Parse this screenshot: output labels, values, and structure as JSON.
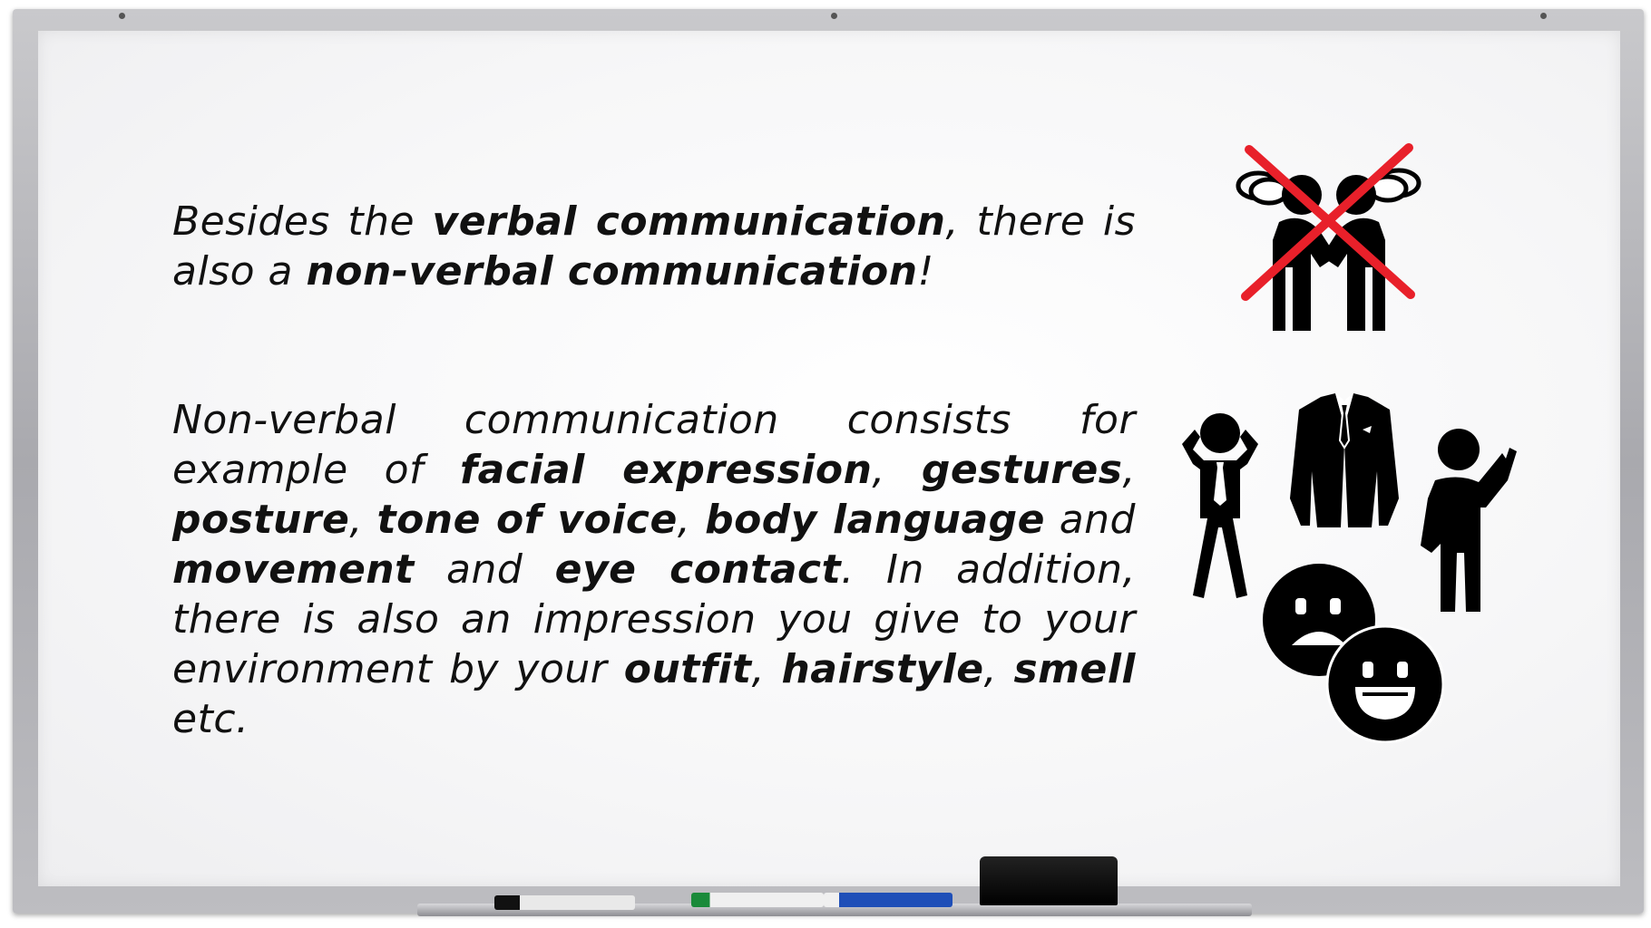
{
  "slide": {
    "para1": {
      "t1": "Besides the ",
      "b1": "verbal communication",
      "t2": ", there is also a ",
      "b2": "non-verbal communication",
      "t3": "!"
    },
    "para2": {
      "t1": "Non-verbal communication consists for example of ",
      "b1": "facial expression",
      "t2": ", ",
      "b2": "gestures",
      "t3": ", ",
      "b3": "posture",
      "t4": ", ",
      "b4": "tone of voice",
      "t5": ", ",
      "b5": "body language",
      "t6": " and ",
      "b6": "movement",
      "t7": " and ",
      "b7": "eye contact",
      "t8": ". In addition, there is also an impression you give to your environment by your ",
      "b8": "outfit",
      "t9": ", ",
      "b9": "hairstyle",
      "t10": ", ",
      "b10": "smell",
      "t11": " etc."
    }
  },
  "icons": [
    "no-talking-people-icon",
    "stressed-person-icon",
    "suit-jacket-icon",
    "pointing-person-icon",
    "sad-face-icon",
    "happy-face-icon"
  ],
  "colors": {
    "cross_red": "#e8202a",
    "ink": "#111111",
    "board": "#f7f7f8",
    "frame": "#b4b4b8"
  }
}
